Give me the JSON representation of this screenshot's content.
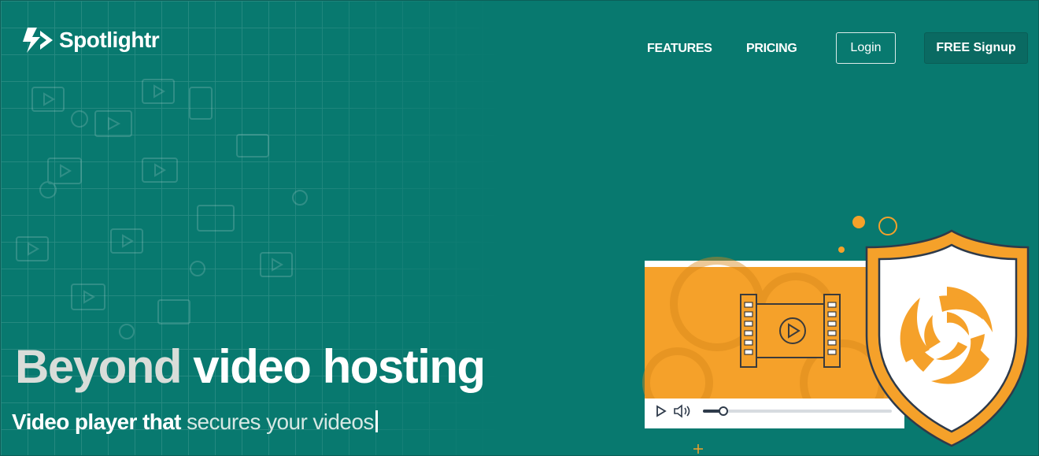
{
  "brand": {
    "name": "Spotlightr"
  },
  "nav": {
    "features_label": "FEATURES",
    "pricing_label": "PRICING",
    "login_label": "Login",
    "signup_label": "FREE Signup"
  },
  "hero": {
    "headline_part1": "Beyond",
    "headline_part2": "video hosting",
    "subline_part1": "Video player that",
    "subline_part2": "secures your videos"
  },
  "colors": {
    "background": "#08796f",
    "accent_orange": "#f5a12a",
    "shield_white": "#ffffff"
  },
  "icons": [
    "spotlightr-logo-icon",
    "play-icon",
    "volume-icon",
    "film-strip-icon",
    "shield-icon",
    "swirl-icon"
  ]
}
